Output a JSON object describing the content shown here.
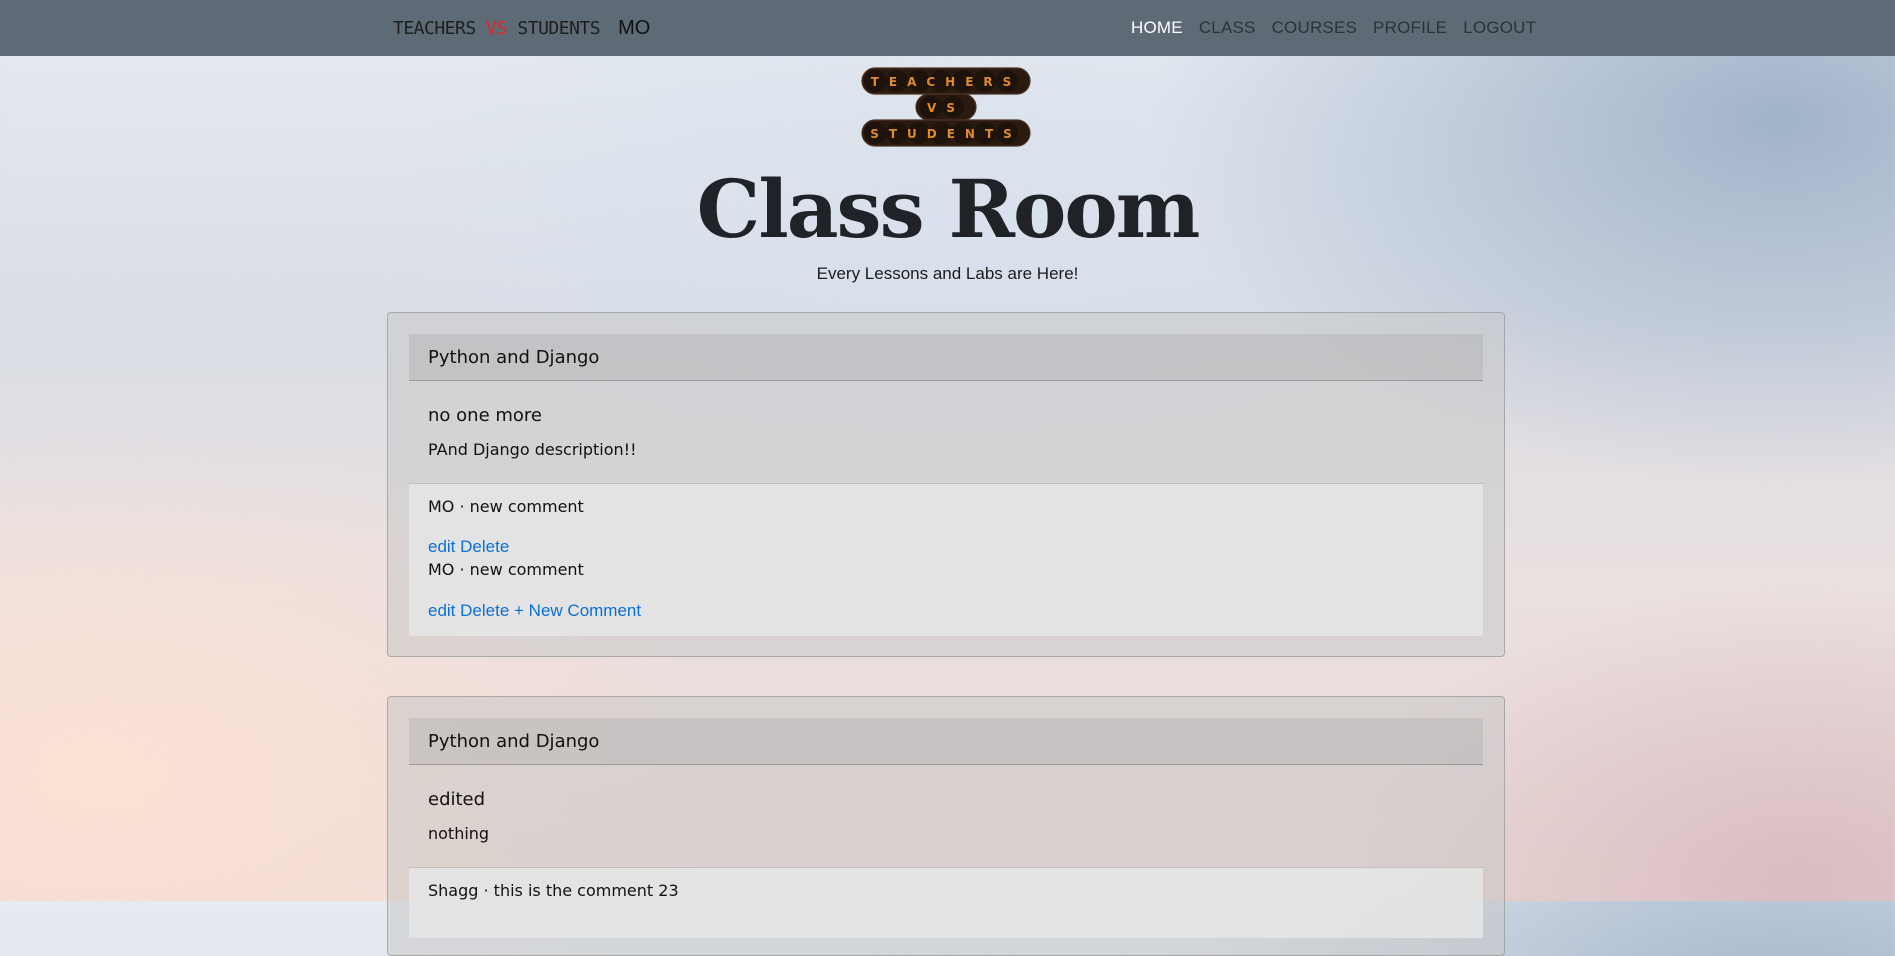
{
  "navbar": {
    "brand_word1": "TEACHERS",
    "brand_vs": "VS",
    "brand_word2": "STUDENTS",
    "user": "MO",
    "links": [
      "HOME",
      "CLASS",
      "COURSES",
      "PROFILE",
      "LOGOUT"
    ],
    "active": "HOME",
    "bg_color": "#5e6b76",
    "active_color": "#ffffff",
    "vs_color": "#e0262b"
  },
  "logo": {
    "lines": [
      "TEACHERS",
      "VS",
      "STUDENTS"
    ]
  },
  "page": {
    "title": "Class Room",
    "subtitle": "Every Lessons and Labs are Here!"
  },
  "cards": [
    {
      "course": "Python and Django",
      "title": "no one more",
      "description": "PAnd Django description!!",
      "comments": [
        {
          "text": "MO · new comment",
          "edit": "edit",
          "delete": "Delete"
        },
        {
          "text": "MO · new comment",
          "edit": "edit",
          "delete": "Delete"
        }
      ],
      "new_comment": "+ New Comment"
    },
    {
      "course": "Python and Django",
      "title": "edited",
      "description": "nothing",
      "comments": [
        {
          "text": "Shagg · this is the comment 23"
        }
      ]
    }
  ],
  "link_color": "#0a6fd6"
}
